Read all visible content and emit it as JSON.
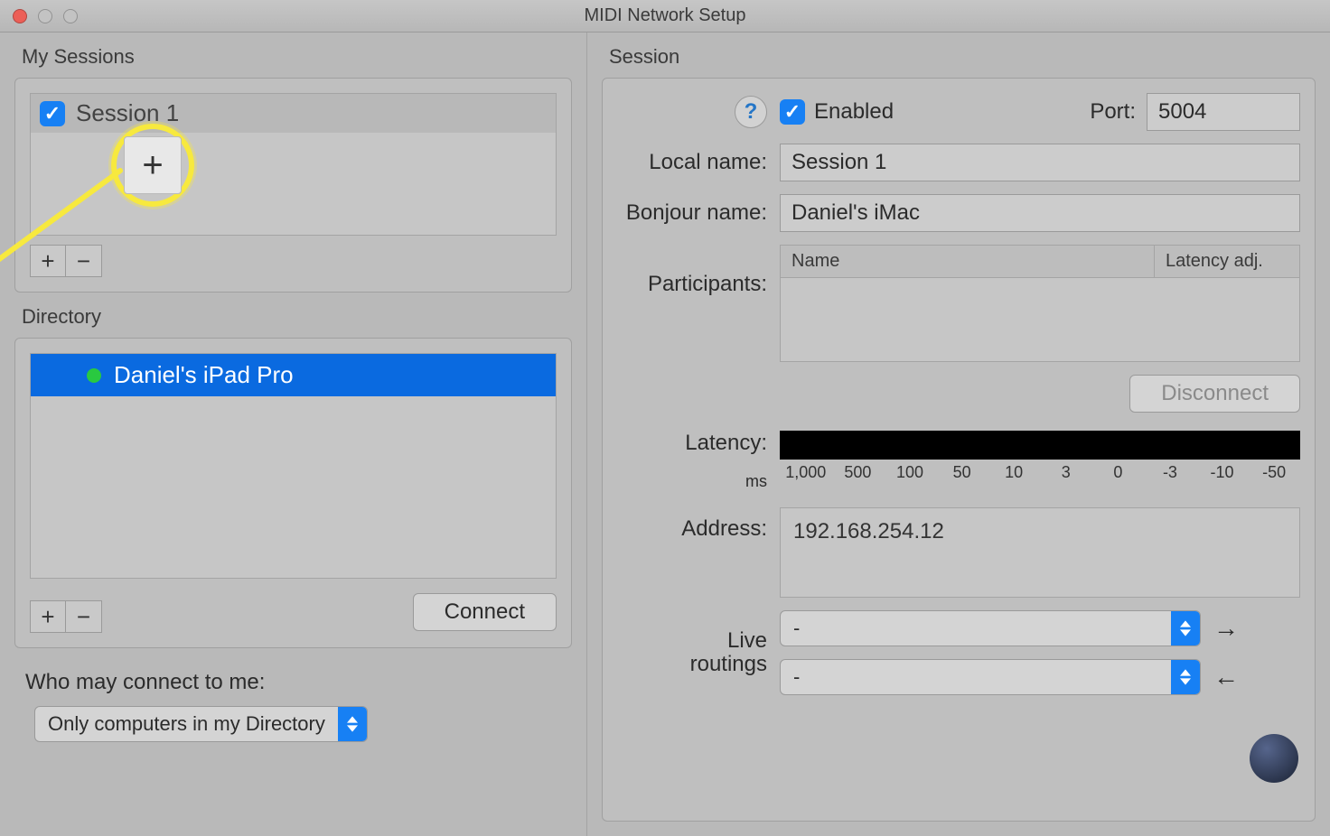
{
  "window": {
    "title": "MIDI Network Setup"
  },
  "mySessions": {
    "label": "My Sessions",
    "items": [
      {
        "enabled": true,
        "name": "Session 1"
      }
    ]
  },
  "directory": {
    "label": "Directory",
    "items": [
      {
        "online": true,
        "name": "Daniel's iPad Pro"
      }
    ],
    "connect_label": "Connect"
  },
  "whoMayConnect": {
    "label": "Who may connect to me:",
    "value": "Only computers in my Directory"
  },
  "sessionPanel": {
    "label": "Session",
    "enabled_label": "Enabled",
    "port_label": "Port:",
    "port_value": "5004",
    "local_name_label": "Local name:",
    "local_name_value": "Session 1",
    "bonjour_label": "Bonjour name:",
    "bonjour_value": "Daniel's iMac",
    "participants_label": "Participants:",
    "table_headers": {
      "name": "Name",
      "latency": "Latency adj."
    },
    "disconnect_label": "Disconnect",
    "latency_label": "Latency:",
    "latency_unit": "ms",
    "latency_ticks": [
      "1,000",
      "500",
      "100",
      "50",
      "10",
      "3",
      "0",
      "-3",
      "-10",
      "-50"
    ],
    "address_label": "Address:",
    "address_value": "192.168.254.12",
    "live_routings_label_l1": "Live",
    "live_routings_label_l2": "routings",
    "routing_out_value": "-",
    "routing_in_value": "-"
  }
}
